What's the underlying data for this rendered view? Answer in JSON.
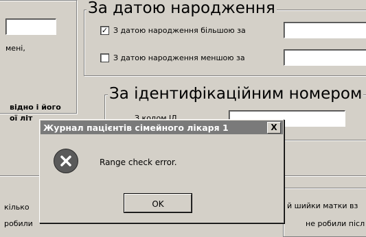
{
  "left_panel": {
    "text_1": "мені,",
    "text_2": "відно і його",
    "text_3": "ої літ",
    "text_4": "кілько",
    "text_5": "робили"
  },
  "dob_group": {
    "title": "За датою народження",
    "greater": {
      "label": "З датою народження більшою за",
      "checked": true,
      "mark": "✓"
    },
    "less": {
      "label": "З датою народження меншою за",
      "checked": false
    }
  },
  "id_group": {
    "title": "За ідентифікаційним номером",
    "partial_label": "З кодом ІД"
  },
  "bottom": {
    "cervix_text": "й шийки матки вз",
    "not_done_text": "не робили післ"
  },
  "dialog": {
    "title": "Журнал пацієнтів сімейного лікаря 1",
    "close": "X",
    "message": "Range check error.",
    "ok_label": "OK"
  }
}
